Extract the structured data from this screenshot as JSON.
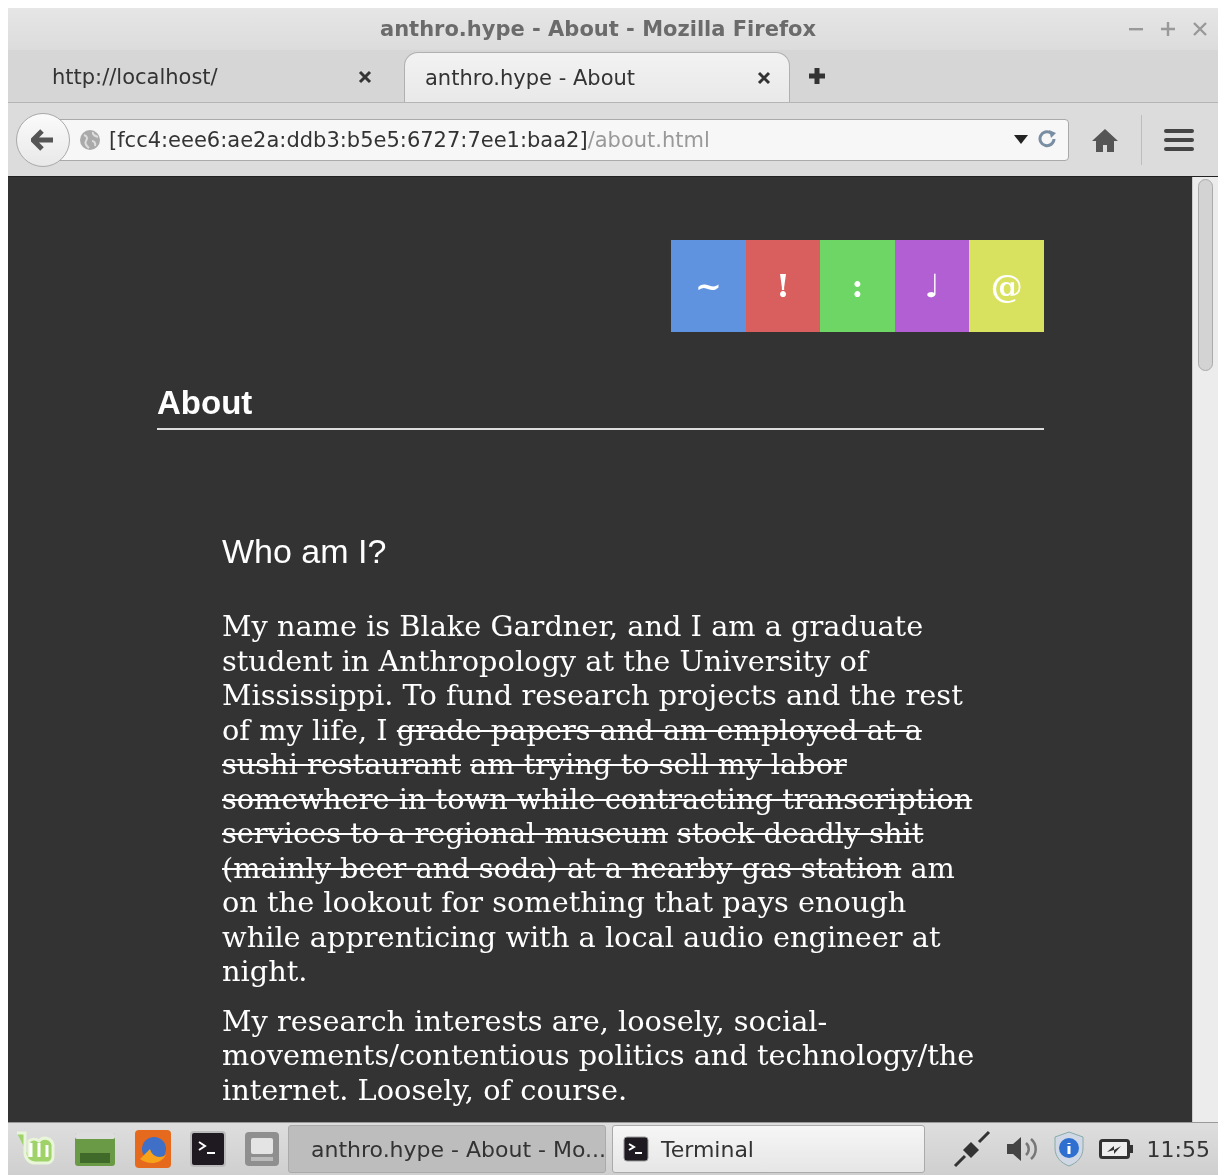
{
  "window": {
    "title": "anthro.hype - About - Mozilla Firefox"
  },
  "tabs": [
    {
      "label": "http://localhost/",
      "selected": false
    },
    {
      "label": "anthro.hype - About",
      "selected": true
    }
  ],
  "address_bar": {
    "host": "[fcc4:eee6:ae2a:ddb3:b5e5:6727:7ee1:baa2]",
    "path": "/about.html"
  },
  "page": {
    "nav_tiles": [
      {
        "label": "~",
        "color": "#5f93e0"
      },
      {
        "label": "!",
        "color": "#d95f5f"
      },
      {
        "label": ":",
        "color": "#6dd664"
      },
      {
        "label": "♩",
        "color": "#b25fd3"
      },
      {
        "label": "@",
        "color": "#d9e25f"
      }
    ],
    "heading": "About",
    "subheading": "Who am I?",
    "paragraphs": [
      {
        "segments": [
          {
            "text": "My name is Blake Gardner, and I am a graduate student in Anthropology at the University of Mississippi. To fund research projects and the rest of my life, I ",
            "struck": false
          },
          {
            "text": "grade papers and am employed at a sushi restaurant",
            "struck": true
          },
          {
            "text": "am trying to sell my labor somewhere in town while contracting transcription services to a regional museum",
            "struck": true
          },
          {
            "text": "stock deadly shit (mainly beer and soda) at a nearby gas station",
            "struck": true
          },
          {
            "text": " am on the lookout for something that pays enough while apprenticing with a local audio engineer at night.",
            "struck": false
          }
        ]
      },
      {
        "segments": [
          {
            "text": "My research interests are, loosely, social-movements/contentious politics and technology/the internet. Loosely, of course.",
            "struck": false
          }
        ]
      }
    ]
  },
  "taskbar": {
    "windows": [
      {
        "label": "anthro.hype - About - Mo...",
        "selected": true
      },
      {
        "label": "Terminal",
        "selected": false
      }
    ],
    "clock": "11:55"
  }
}
